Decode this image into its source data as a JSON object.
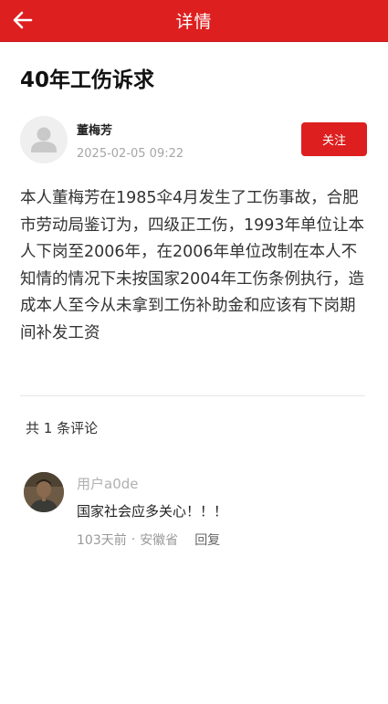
{
  "header": {
    "title": "详情"
  },
  "post": {
    "title": "40年工伤诉求",
    "author_name": "董梅芳",
    "time": "2025-02-05 09:22",
    "follow_label": "关注",
    "body": "本人董梅芳在1985伞4月发生了工伤事故，合肥市劳动局鉴订为，四级正工伤，1993年单位让本人下岗至2006年，在2006年单位改制在本人不知情的情况下未按国家2004年工伤条例执行，造成本人至今从未拿到工伤补助金和应该有下岗期间补发工资"
  },
  "comments": {
    "count_label": "共 1 条评论",
    "items": [
      {
        "user": "用户a0de",
        "text": "国家社会应多关心！！！",
        "time_ago": "103天前",
        "separator": "·",
        "location": "安徽省",
        "reply_label": "回复"
      }
    ]
  },
  "colors": {
    "brand_red": "#dd1f1f",
    "muted_text": "#a6a6a6"
  },
  "icons": {
    "back": "arrow-left-icon",
    "avatar_placeholder": "user-silhouette-icon"
  }
}
